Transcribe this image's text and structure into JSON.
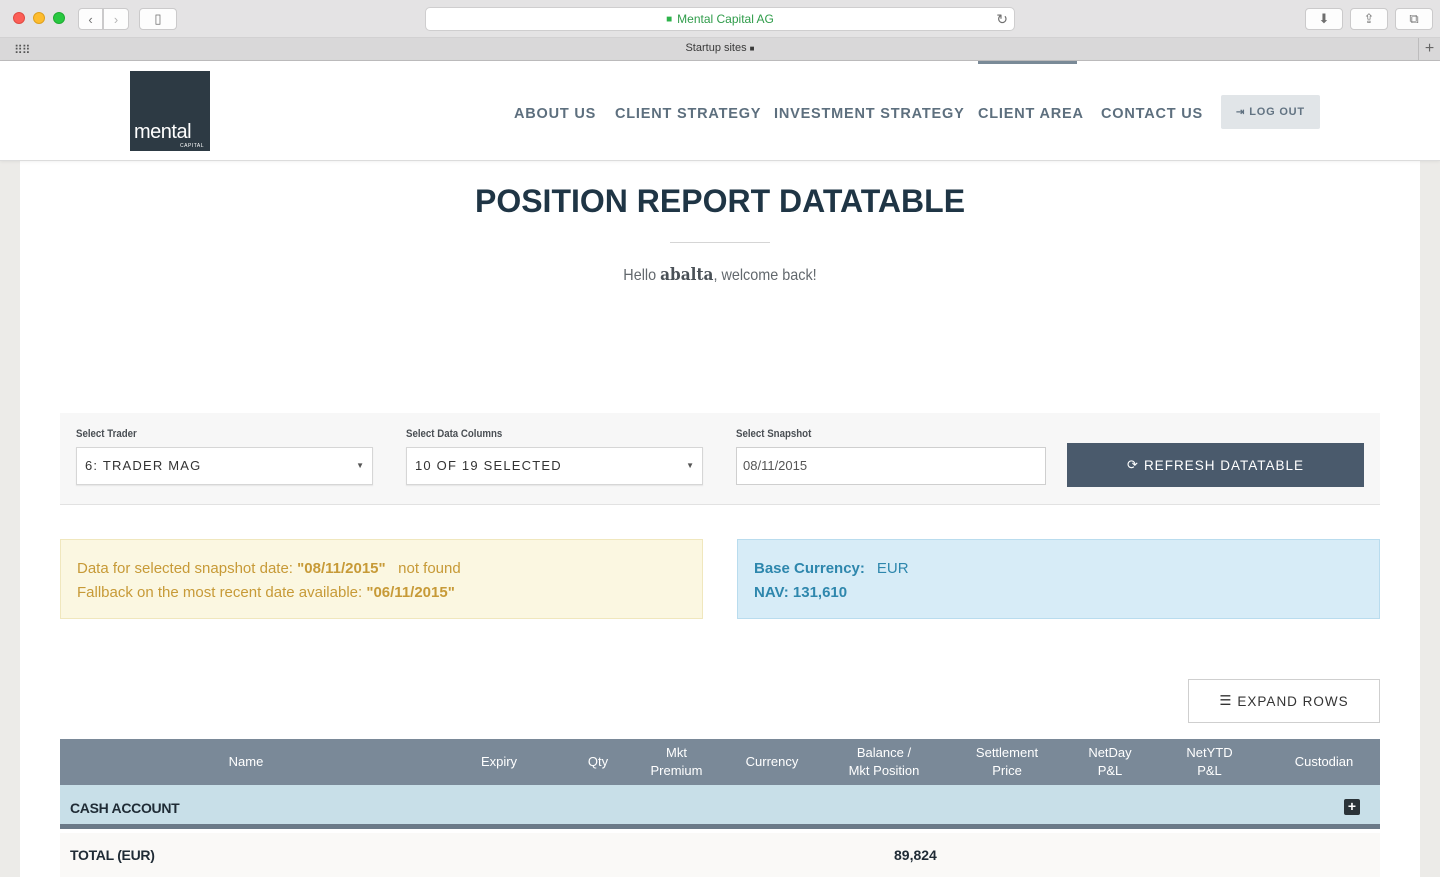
{
  "browser": {
    "address": "Mental Capital AG",
    "tab_title": "Startup sites"
  },
  "header": {
    "logo_word": "mental",
    "logo_small": "CAPITAL",
    "nav": [
      "ABOUT US",
      "CLIENT STRATEGY",
      "INVESTMENT STRATEGY",
      "CLIENT AREA",
      "CONTACT US"
    ],
    "active_nav": "CLIENT AREA",
    "logout_label": "LOG OUT"
  },
  "page": {
    "title": "POSITION REPORT DATATABLE",
    "welcome_prefix": "Hello",
    "username": "abalta",
    "welcome_suffix": ", welcome back!"
  },
  "filters": {
    "trader_label": "Select Trader",
    "trader_value": "6: TRADER MAG",
    "columns_label": "Select Data Columns",
    "columns_value": "10 OF 19 SELECTED",
    "snapshot_label": "Select Snapshot",
    "snapshot_value": "08/11/2015",
    "refresh_label": "REFRESH DATATABLE"
  },
  "warning": {
    "line1_prefix": "Data for selected snapshot date:",
    "line1_date": "\"08/11/2015\"",
    "line1_suffix": "not found",
    "line2_prefix": "Fallback on the most recent date available:",
    "line2_date": "\"06/11/2015\""
  },
  "info": {
    "base_currency_label": "Base Currency:",
    "base_currency_value": "EUR",
    "nav_label": "NAV: 131,610"
  },
  "table": {
    "expand_label": "EXPAND ROWS",
    "headers": [
      {
        "l1": "Name",
        "l2": ""
      },
      {
        "l1": "Expiry",
        "l2": ""
      },
      {
        "l1": "Qty",
        "l2": ""
      },
      {
        "l1": "Mkt",
        "l2": "Premium"
      },
      {
        "l1": "Currency",
        "l2": ""
      },
      {
        "l1": "Balance /",
        "l2": "Mkt Position"
      },
      {
        "l1": "Settlement",
        "l2": "Price"
      },
      {
        "l1": "NetDay",
        "l2": "P&L"
      },
      {
        "l1": "NetYTD",
        "l2": "P&L"
      },
      {
        "l1": "Custodian",
        "l2": ""
      }
    ],
    "group_label": "CASH ACCOUNT",
    "total_label": "TOTAL (EUR)",
    "total_balance": "89,824"
  }
}
